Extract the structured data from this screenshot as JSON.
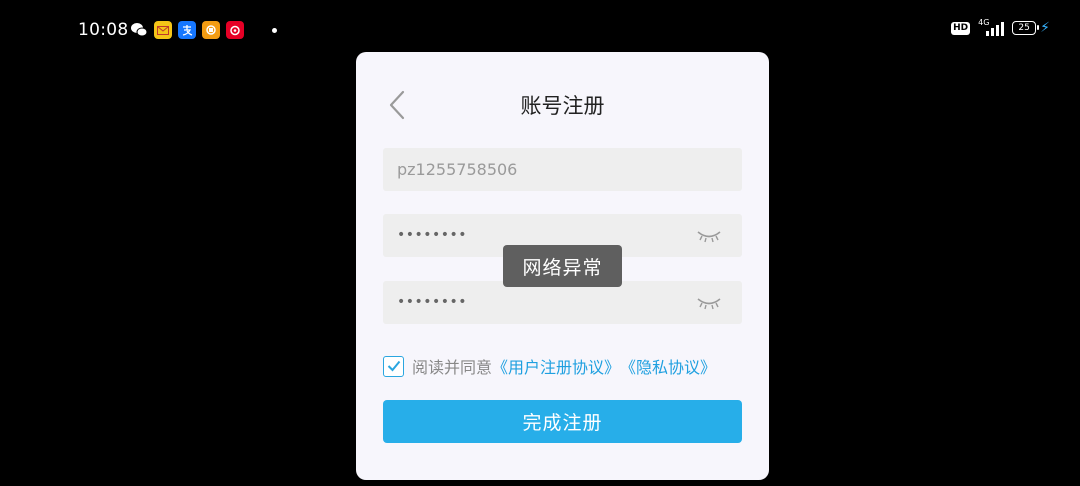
{
  "status_bar": {
    "time": "10:08",
    "notification_icons": [
      "wechat-icon",
      "mail-icon",
      "alipay-icon",
      "app-icon",
      "netease-music-icon"
    ],
    "hd_label": "HD",
    "network": "4G",
    "battery": "25"
  },
  "dialog": {
    "title": "账号注册",
    "username_value": "pz1255758506",
    "password_value": "••••••••",
    "confirm_password_value": "••••••••",
    "agree_prefix": "阅读并同意",
    "user_agreement_link": "《用户注册协议》",
    "privacy_link": "《隐私协议》",
    "submit_label": "完成注册",
    "agree_checked": true
  },
  "toast": {
    "message": "网络异常"
  },
  "colors": {
    "accent": "#27aee9",
    "link": "#1fa0e0",
    "dialog_bg": "#f7f6fc",
    "field_bg": "#eeeeee"
  }
}
